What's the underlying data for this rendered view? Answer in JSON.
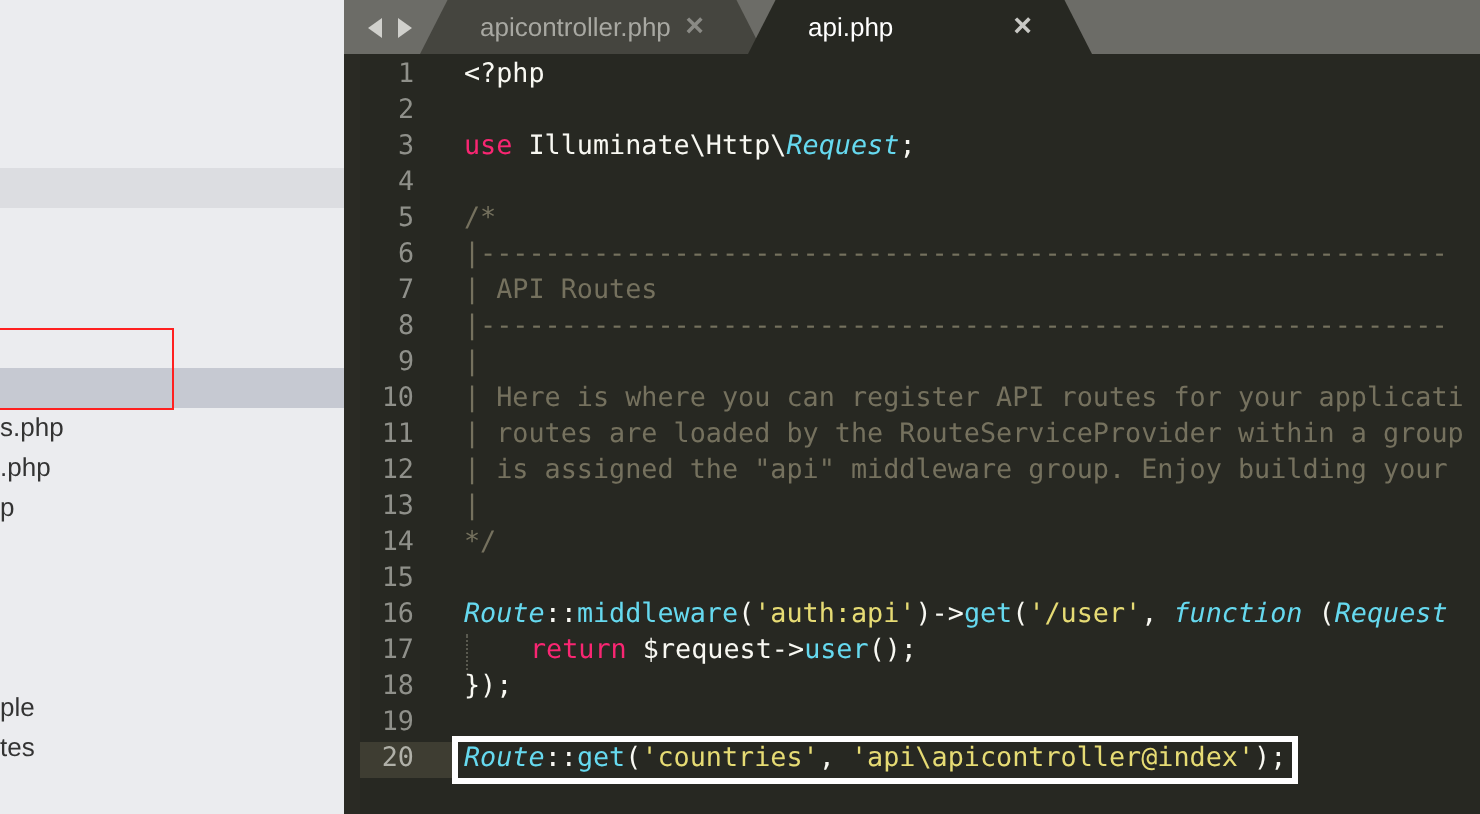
{
  "sidebar": {
    "rows": [
      {
        "kind": "file",
        "selected": false
      },
      {
        "kind": "file",
        "selected": false
      },
      {
        "kind": "file",
        "selected": false
      },
      {
        "kind": "file",
        "selected": false
      },
      {
        "kind": "header",
        "selected": false
      },
      {
        "kind": "file",
        "selected": false
      },
      {
        "kind": "file",
        "selected": false
      },
      {
        "kind": "file",
        "selected": false
      },
      {
        "kind": "file",
        "selected": false
      },
      {
        "kind": "file",
        "selected": true
      },
      {
        "kind": "file",
        "label": "s.php",
        "selected": false
      },
      {
        "kind": "file",
        "label": ".php",
        "selected": false
      },
      {
        "kind": "file",
        "label": "p",
        "selected": false
      },
      {
        "kind": "file",
        "selected": false
      },
      {
        "kind": "file",
        "selected": false
      },
      {
        "kind": "file",
        "selected": false
      },
      {
        "kind": "file",
        "selected": false
      },
      {
        "kind": "file",
        "label": "ple",
        "selected": false
      },
      {
        "kind": "file",
        "label": "tes",
        "selected": false
      }
    ]
  },
  "tabs": [
    {
      "label": "apicontroller.php",
      "close": "×",
      "selected": false
    },
    {
      "label": "api.php",
      "close": "×",
      "selected": true
    }
  ],
  "editor": {
    "lines": [
      {
        "number": "1",
        "current": false,
        "boxed": false,
        "tokens": [
          {
            "text": "<?php",
            "kind": "plain"
          }
        ]
      },
      {
        "number": "2",
        "current": false,
        "boxed": false
      },
      {
        "number": "3",
        "current": false,
        "boxed": false,
        "tokens": [
          {
            "text": "use",
            "kind": "keyword"
          },
          {
            "text": " Illuminate\\Http\\",
            "kind": "plain"
          },
          {
            "text": "Request",
            "kind": "type"
          },
          {
            "text": ";",
            "kind": "plain"
          }
        ]
      },
      {
        "number": "4",
        "current": false,
        "boxed": false
      },
      {
        "number": "5",
        "current": false,
        "boxed": false,
        "tokens": [
          {
            "text": "/*",
            "kind": "comment"
          }
        ]
      },
      {
        "number": "6",
        "current": false,
        "boxed": false,
        "tokens": [
          {
            "text": "|------------------------------------------------------------",
            "kind": "comment"
          }
        ]
      },
      {
        "number": "7",
        "current": false,
        "boxed": false,
        "tokens": [
          {
            "text": "| API Routes",
            "kind": "comment"
          }
        ]
      },
      {
        "number": "8",
        "current": false,
        "boxed": false,
        "tokens": [
          {
            "text": "|------------------------------------------------------------",
            "kind": "comment"
          }
        ]
      },
      {
        "number": "9",
        "current": false,
        "boxed": false,
        "tokens": [
          {
            "text": "|",
            "kind": "comment"
          }
        ]
      },
      {
        "number": "10",
        "current": false,
        "boxed": false,
        "tokens": [
          {
            "text": "| Here is where you can register API routes for your applicati",
            "kind": "comment"
          }
        ]
      },
      {
        "number": "11",
        "current": false,
        "boxed": false,
        "tokens": [
          {
            "text": "| routes are loaded by the RouteServiceProvider within a group",
            "kind": "comment"
          }
        ]
      },
      {
        "number": "12",
        "current": false,
        "boxed": false,
        "tokens": [
          {
            "text": "| is assigned the \"api\" middleware group. Enjoy building your",
            "kind": "comment"
          }
        ]
      },
      {
        "number": "13",
        "current": false,
        "boxed": false,
        "tokens": [
          {
            "text": "|",
            "kind": "comment"
          }
        ]
      },
      {
        "number": "14",
        "current": false,
        "boxed": false,
        "tokens": [
          {
            "text": "*/",
            "kind": "comment"
          }
        ]
      },
      {
        "number": "15",
        "current": false,
        "boxed": false
      },
      {
        "number": "16",
        "current": false,
        "boxed": false,
        "tokens": [
          {
            "text": "Route",
            "kind": "type"
          },
          {
            "text": "::",
            "kind": "plain"
          },
          {
            "text": "middleware",
            "kind": "func"
          },
          {
            "text": "(",
            "kind": "plain"
          },
          {
            "text": "'auth:api'",
            "kind": "string"
          },
          {
            "text": ")->",
            "kind": "plain"
          },
          {
            "text": "get",
            "kind": "func"
          },
          {
            "text": "(",
            "kind": "plain"
          },
          {
            "text": "'/user'",
            "kind": "string"
          },
          {
            "text": ", ",
            "kind": "plain"
          },
          {
            "text": "function",
            "kind": "type"
          },
          {
            "text": " (",
            "kind": "plain"
          },
          {
            "text": "Request",
            "kind": "type"
          }
        ]
      },
      {
        "number": "17",
        "current": false,
        "boxed": false,
        "indented": true,
        "tokens": [
          {
            "text": "return",
            "kind": "keyword"
          },
          {
            "text": " $request->",
            "kind": "plain"
          },
          {
            "text": "user",
            "kind": "func"
          },
          {
            "text": "();",
            "kind": "plain"
          }
        ]
      },
      {
        "number": "18",
        "current": false,
        "boxed": false,
        "tokens": [
          {
            "text": "});",
            "kind": "plain"
          }
        ]
      },
      {
        "number": "19",
        "current": false,
        "boxed": false
      },
      {
        "number": "20",
        "current": true,
        "boxed": true,
        "tokens": [
          {
            "text": "Route",
            "kind": "type"
          },
          {
            "text": "::",
            "kind": "plain"
          },
          {
            "text": "get",
            "kind": "func"
          },
          {
            "text": "(",
            "kind": "plain"
          },
          {
            "text": "'countries'",
            "kind": "string"
          },
          {
            "text": ", ",
            "kind": "plain"
          },
          {
            "text": "'api\\apicontroller@index'",
            "kind": "string"
          },
          {
            "text": ");",
            "kind": "plain"
          }
        ]
      }
    ]
  }
}
